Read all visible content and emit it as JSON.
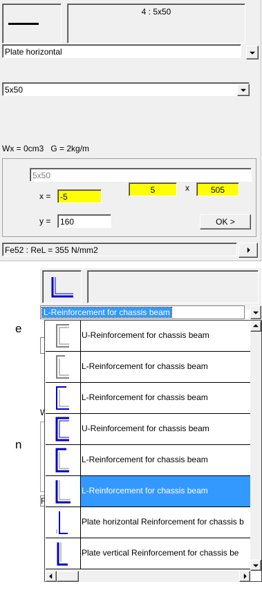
{
  "top_panel": {
    "profile_code": "4 : 5x50",
    "profile_type": "Plate horizontal",
    "profile_size": "5x50",
    "properties": "Wx = 0cm3   G = 2kg/m",
    "section_name": "5x50",
    "x_label": "x =",
    "x_value": "-5",
    "y_label": "y =",
    "y_value": "160",
    "dim_a": "5",
    "dim_sep": "x",
    "dim_b": "505",
    "ok_label": "OK >",
    "material": "Fe52 : ReL = 355 N/mm2",
    "colors": {
      "field_highlight": "#ffff00",
      "panel_bg": "#f0f0f0"
    }
  },
  "bottom_panel": {
    "selected_value": "L-Reinforcement for chassis beam",
    "options": [
      {
        "label": "U-Reinforcement for chassis beam",
        "icon": "u-channel-grey-icon"
      },
      {
        "label": "L-Reinforcement for chassis beam",
        "icon": "l-angle-grey-icon"
      },
      {
        "label": "L-Reinforcement for chassis beam",
        "icon": "l-angle-blue-icon"
      },
      {
        "label": "U-Reinforcement for chassis beam",
        "icon": "u-channel-blue-icon"
      },
      {
        "label": "L-Reinforcement for chassis beam",
        "icon": "l-angle-blue-icon"
      },
      {
        "label": "L-Reinforcement for chassis beam",
        "icon": "l-angle-blue-icon"
      },
      {
        "label": "Plate horizontal Reinforcement for chassis b",
        "icon": "plate-horizontal-icon"
      },
      {
        "label": "Plate vertical Reinforcement for chassis be",
        "icon": "plate-vertical-icon"
      }
    ],
    "selected_index": 5,
    "colors": {
      "selection": "#3399ff",
      "icon_blue": "#0000cc"
    }
  },
  "background_fragments": [
    "e",
    "W",
    "n",
    "F"
  ]
}
